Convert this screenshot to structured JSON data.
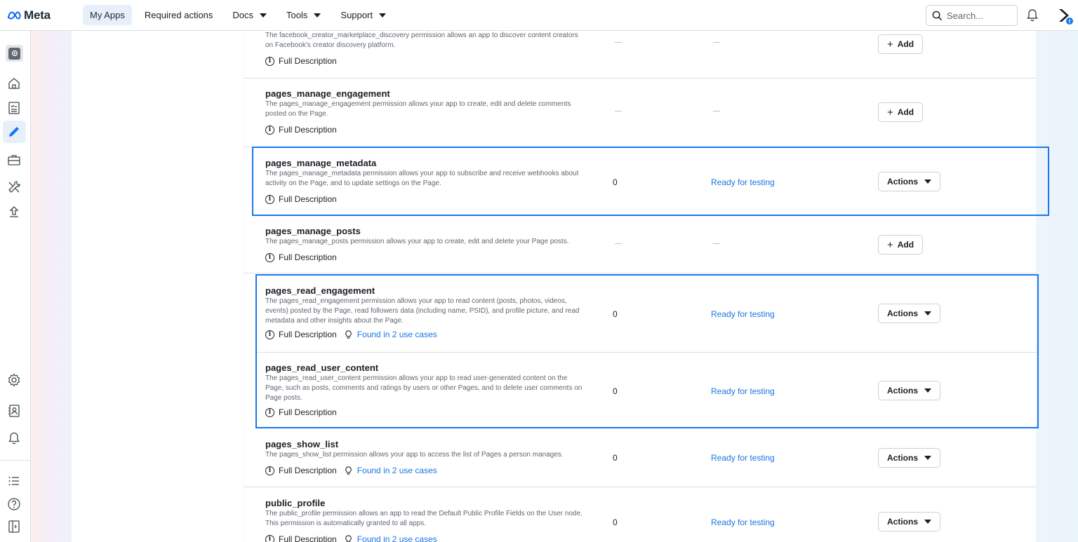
{
  "topnav": {
    "brand": "Meta",
    "items": [
      {
        "label": "My Apps",
        "active": true,
        "dropdown": false
      },
      {
        "label": "Required actions",
        "active": false,
        "dropdown": false
      },
      {
        "label": "Docs",
        "active": false,
        "dropdown": true
      },
      {
        "label": "Tools",
        "active": false,
        "dropdown": true
      },
      {
        "label": "Support",
        "active": false,
        "dropdown": true
      }
    ],
    "search_placeholder": "Search..."
  },
  "sidebar_icons": [
    "app-icon",
    "home-icon",
    "checklist-icon",
    "pencil-icon",
    "briefcase-icon",
    "tools-icon",
    "upload-icon",
    "settings-icon",
    "contact-icon",
    "bell-icon",
    "list-icon",
    "help-icon",
    "panel-toggle-icon"
  ],
  "permissions": {
    "full_description_label": "Full Description",
    "rows": [
      {
        "name": "",
        "description": "The facebook_creator_marketplace_discovery permission allows an app to discover content creators on Facebook's creator discovery platform.",
        "use_cases": "",
        "count": "",
        "status": "",
        "action": "Add"
      },
      {
        "name": "pages_manage_engagement",
        "description": "The pages_manage_engagement permission allows your app to create, edit and delete comments posted on the Page.",
        "use_cases": "",
        "count": "",
        "status": "",
        "action": "Add"
      },
      {
        "name": "pages_manage_metadata",
        "description": "The pages_manage_metadata permission allows your app to subscribe and receive webhooks about activity on the Page, and to update settings on the Page.",
        "use_cases": "",
        "count": "0",
        "status": "Ready for testing",
        "action": "Actions"
      },
      {
        "name": "pages_manage_posts",
        "description": "The pages_manage_posts permission allows your app to create, edit and delete your Page posts.",
        "use_cases": "",
        "count": "",
        "status": "",
        "action": "Add"
      },
      {
        "name": "pages_read_engagement",
        "description": "The pages_read_engagement permission allows your app to read content (posts, photos, videos, events) posted by the Page, read followers data (including name, PSID), and profile picture, and read metadata and other insights about the Page.",
        "use_cases": "Found in 2 use cases",
        "count": "0",
        "status": "Ready for testing",
        "action": "Actions"
      },
      {
        "name": "pages_read_user_content",
        "description": "The pages_read_user_content permission allows your app to read user-generated content on the Page, such as posts, comments and ratings by users or other Pages, and to delete user comments on Page posts.",
        "use_cases": "",
        "count": "0",
        "status": "Ready for testing",
        "action": "Actions"
      },
      {
        "name": "pages_show_list",
        "description": "The pages_show_list permission allows your app to access the list of Pages a person manages.",
        "use_cases": "Found in 2 use cases",
        "count": "0",
        "status": "Ready for testing",
        "action": "Actions"
      },
      {
        "name": "public_profile",
        "description": "The public_profile permission allows an app to read the Default Public Profile Fields on the User node. This permission is automatically granted to all apps.",
        "use_cases": "Found in 2 use cases",
        "count": "0",
        "status": "Ready for testing",
        "action": "Actions"
      }
    ]
  }
}
